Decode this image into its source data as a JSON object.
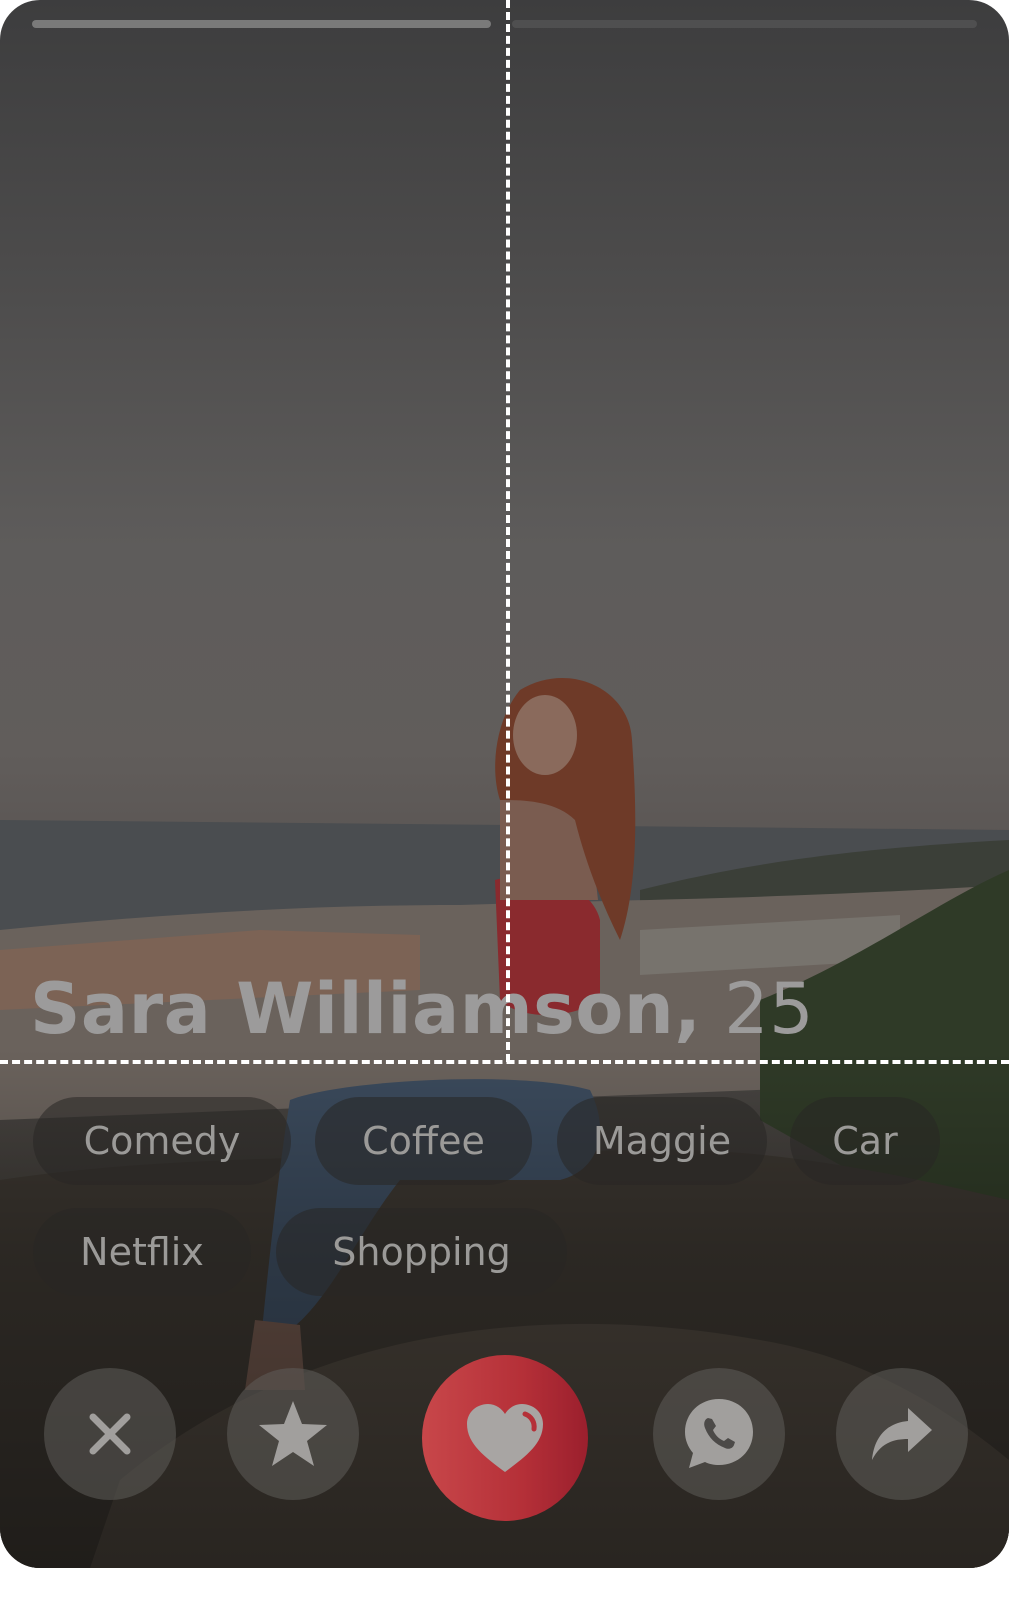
{
  "profile": {
    "name": "Sara Williamson,",
    "age": "25"
  },
  "photo_progress": {
    "total": 2,
    "current": 1
  },
  "interests": [
    "Comedy",
    "Coffee",
    "Maggie",
    "Car",
    "Netflix",
    "Shopping"
  ],
  "actions": {
    "dismiss_icon": "close-icon",
    "super_like_icon": "star-icon",
    "like_icon": "heart-icon",
    "chat_icon": "phone-chat-icon",
    "share_icon": "share-icon"
  },
  "colors": {
    "like_button": "#b53038",
    "chip_text": "#9b9a98",
    "name_text": "#9c9b9b"
  }
}
